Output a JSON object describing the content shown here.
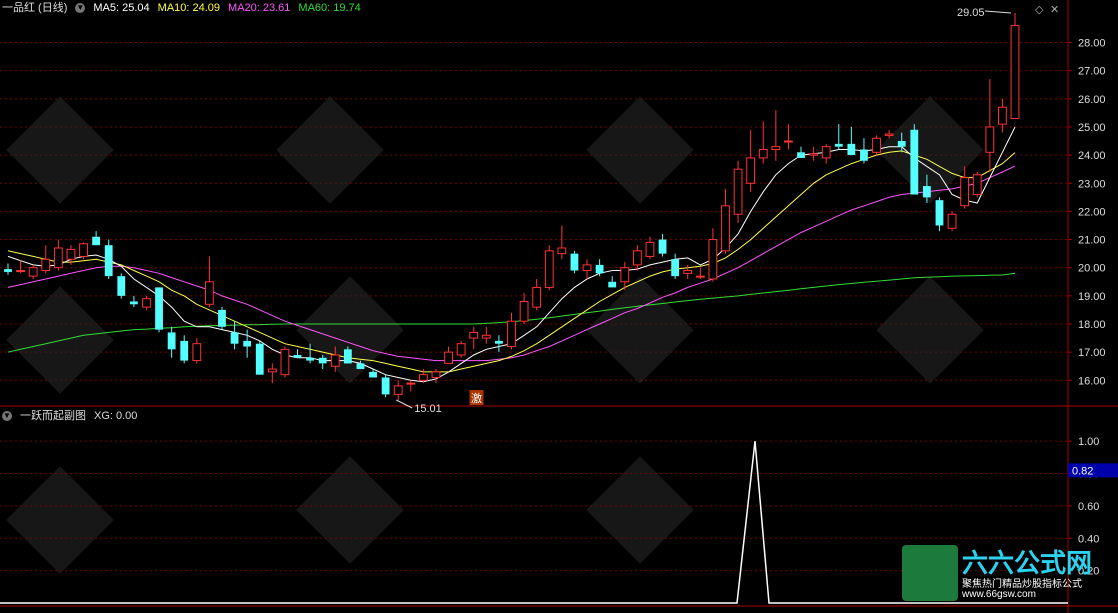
{
  "main_panel": {
    "stock_name": "一品红 (日线)",
    "ma_lines": [
      {
        "label": "MA5: 25.04",
        "color": "#ffffff"
      },
      {
        "label": "MA10: 24.09",
        "color": "#ffff4c"
      },
      {
        "label": "MA20: 23.61",
        "color": "#ff55ff"
      },
      {
        "label": "MA60: 19.74",
        "color": "#33dd33"
      }
    ],
    "high_label": "29.05",
    "low_label": "15.01",
    "signal_char": "激",
    "colors": {
      "up": "#ff3333",
      "down": "#54ffff",
      "grid": "#7a0000",
      "axis": "#aa0000",
      "label": "#dddddd"
    }
  },
  "sub_panel": {
    "title": "一跃而起副图",
    "xg_label": "XG: 0.00",
    "current_value_tag": "0.82",
    "colors": {
      "line": "#ffffff",
      "tag_bg": "#0000aa"
    }
  },
  "watermark": {
    "brand": "六六公式网",
    "slogan": "聚焦热门精品炒股指标公式",
    "url": "www.66gsw.com"
  },
  "chart_data": [
    {
      "type": "candlestick",
      "yticks": [
        16,
        17,
        18,
        19,
        20,
        21,
        22,
        23,
        24,
        25,
        26,
        27,
        28
      ],
      "ylim": [
        15.3,
        28.8
      ],
      "candles": [
        [
          19.95,
          20.15,
          19.75,
          19.85
        ],
        [
          19.9,
          20.25,
          19.8,
          19.9
        ],
        [
          19.7,
          20.1,
          19.6,
          20.0
        ],
        [
          19.9,
          20.8,
          19.8,
          20.3
        ],
        [
          20.0,
          21.0,
          19.9,
          20.7
        ],
        [
          20.3,
          20.8,
          20.1,
          20.65
        ],
        [
          20.4,
          20.9,
          20.3,
          20.85
        ],
        [
          21.1,
          21.3,
          20.8,
          20.8
        ],
        [
          20.8,
          21.0,
          19.6,
          19.7
        ],
        [
          19.7,
          19.8,
          18.9,
          19.0
        ],
        [
          18.8,
          19.0,
          18.6,
          18.7
        ],
        [
          18.6,
          19.0,
          18.5,
          18.9
        ],
        [
          19.3,
          19.3,
          17.7,
          17.8
        ],
        [
          17.7,
          17.9,
          16.8,
          17.1
        ],
        [
          17.4,
          17.6,
          16.6,
          16.7
        ],
        [
          16.7,
          17.5,
          16.6,
          17.3
        ],
        [
          18.7,
          20.4,
          18.6,
          19.5
        ],
        [
          18.5,
          18.6,
          17.8,
          17.9
        ],
        [
          17.7,
          18.1,
          17.1,
          17.3
        ],
        [
          17.4,
          17.8,
          16.8,
          17.2
        ],
        [
          17.3,
          17.4,
          16.2,
          16.2
        ],
        [
          16.3,
          16.6,
          15.9,
          16.4
        ],
        [
          16.2,
          17.2,
          16.1,
          17.1
        ],
        [
          16.9,
          17.1,
          16.8,
          16.8
        ],
        [
          16.8,
          17.3,
          16.6,
          16.7
        ],
        [
          16.8,
          16.9,
          16.4,
          16.6
        ],
        [
          16.5,
          17.2,
          16.3,
          16.9
        ],
        [
          17.1,
          17.2,
          16.6,
          16.6
        ],
        [
          16.6,
          16.7,
          16.4,
          16.4
        ],
        [
          16.3,
          16.4,
          16.1,
          16.1
        ],
        [
          16.1,
          16.2,
          15.4,
          15.5
        ],
        [
          15.5,
          16.0,
          15.3,
          15.8
        ],
        [
          15.9,
          16.0,
          15.6,
          15.9
        ],
        [
          16.0,
          16.4,
          15.9,
          16.2
        ],
        [
          16.1,
          16.4,
          15.9,
          16.3
        ],
        [
          16.6,
          17.2,
          16.6,
          17.0
        ],
        [
          16.9,
          17.4,
          16.8,
          17.3
        ],
        [
          17.5,
          17.9,
          17.1,
          17.7
        ],
        [
          17.5,
          17.9,
          17.3,
          17.6
        ],
        [
          17.4,
          17.6,
          17.0,
          17.3
        ],
        [
          17.2,
          18.4,
          17.1,
          18.1
        ],
        [
          18.1,
          19.1,
          18.0,
          18.8
        ],
        [
          18.6,
          19.6,
          18.5,
          19.3
        ],
        [
          19.3,
          20.8,
          19.2,
          20.6
        ],
        [
          20.5,
          21.5,
          20.3,
          20.7
        ],
        [
          20.5,
          20.6,
          19.8,
          19.9
        ],
        [
          19.9,
          20.3,
          19.6,
          20.1
        ],
        [
          20.1,
          20.3,
          19.7,
          19.8
        ],
        [
          19.5,
          19.7,
          19.3,
          19.3
        ],
        [
          19.5,
          20.2,
          19.2,
          20.0
        ],
        [
          20.1,
          20.8,
          19.9,
          20.6
        ],
        [
          20.4,
          21.1,
          20.3,
          20.9
        ],
        [
          21.0,
          21.2,
          20.4,
          20.5
        ],
        [
          20.3,
          20.5,
          19.6,
          19.7
        ],
        [
          19.8,
          20.1,
          19.6,
          19.9
        ],
        [
          19.7,
          20.0,
          19.6,
          19.7
        ],
        [
          19.6,
          21.4,
          19.5,
          21.0
        ],
        [
          20.6,
          22.8,
          20.5,
          22.2
        ],
        [
          21.9,
          23.8,
          21.6,
          23.5
        ],
        [
          23.0,
          24.9,
          22.7,
          23.9
        ],
        [
          23.9,
          25.2,
          23.7,
          24.2
        ],
        [
          24.2,
          25.6,
          23.8,
          24.3
        ],
        [
          24.5,
          25.1,
          24.2,
          24.5
        ],
        [
          24.1,
          24.3,
          23.9,
          23.9
        ],
        [
          24.0,
          24.3,
          23.8,
          24.05
        ],
        [
          23.9,
          24.4,
          23.7,
          24.3
        ],
        [
          24.4,
          25.1,
          24.2,
          24.3
        ],
        [
          24.4,
          25.0,
          24.1,
          24.0
        ],
        [
          24.2,
          24.6,
          23.7,
          23.8
        ],
        [
          24.1,
          24.7,
          24.0,
          24.6
        ],
        [
          24.7,
          24.9,
          24.6,
          24.75
        ],
        [
          24.5,
          24.8,
          24.1,
          24.3
        ],
        [
          24.9,
          25.1,
          22.6,
          22.6
        ],
        [
          22.9,
          23.3,
          22.3,
          22.5
        ],
        [
          22.4,
          22.5,
          21.3,
          21.5
        ],
        [
          21.4,
          22.0,
          21.3,
          21.9
        ],
        [
          22.2,
          23.6,
          22.1,
          23.2
        ],
        [
          22.6,
          23.4,
          22.5,
          23.3
        ],
        [
          24.1,
          26.7,
          23.4,
          25.0
        ],
        [
          25.1,
          26.0,
          24.8,
          25.7
        ],
        [
          25.3,
          29.05,
          25.3,
          28.6
        ]
      ],
      "ma": {
        "MA5": [
          20.4,
          20.25,
          20.1,
          20.05,
          20.1,
          20.3,
          20.4,
          20.45,
          20.3,
          20.05,
          19.6,
          19.3,
          19.0,
          18.6,
          18.1,
          17.9,
          17.9,
          17.8,
          17.7,
          17.6,
          17.4,
          17.1,
          16.9,
          16.8,
          16.8,
          16.7,
          16.7,
          16.7,
          16.6,
          16.4,
          16.2,
          16.1,
          16.0,
          15.95,
          16.05,
          16.3,
          16.6,
          16.9,
          17.1,
          17.2,
          17.3,
          17.6,
          17.9,
          18.4,
          18.9,
          19.3,
          19.6,
          19.8,
          19.9,
          19.9,
          19.95,
          20.1,
          20.2,
          20.3,
          20.35,
          20.1,
          20.3,
          20.7,
          21.2,
          22.0,
          22.7,
          23.3,
          23.7,
          24.0,
          24.05,
          24.1,
          24.2,
          24.2,
          24.15,
          24.2,
          24.3,
          24.3,
          23.9,
          23.6,
          23.3,
          22.6,
          22.4,
          22.3,
          23.2,
          24.1,
          25.0
        ],
        "MA10": [
          20.6,
          20.5,
          20.4,
          20.3,
          20.2,
          20.2,
          20.25,
          20.3,
          20.2,
          20.1,
          19.9,
          19.7,
          19.5,
          19.2,
          19.0,
          18.7,
          18.5,
          18.3,
          18.1,
          17.9,
          17.7,
          17.5,
          17.3,
          17.2,
          17.1,
          17.0,
          16.9,
          16.8,
          16.75,
          16.7,
          16.6,
          16.5,
          16.4,
          16.3,
          16.3,
          16.3,
          16.4,
          16.5,
          16.6,
          16.7,
          16.85,
          17.05,
          17.3,
          17.6,
          17.9,
          18.2,
          18.5,
          18.8,
          19.05,
          19.3,
          19.5,
          19.7,
          19.85,
          19.95,
          20.0,
          20.05,
          20.15,
          20.35,
          20.65,
          21.0,
          21.4,
          21.8,
          22.2,
          22.6,
          23.0,
          23.3,
          23.5,
          23.7,
          23.85,
          24.0,
          24.1,
          24.15,
          24.0,
          23.85,
          23.6,
          23.35,
          23.2,
          23.2,
          23.45,
          23.7,
          24.09
        ],
        "MA20": [
          19.3,
          19.4,
          19.5,
          19.6,
          19.7,
          19.8,
          19.9,
          20.0,
          20.05,
          20.05,
          20.0,
          19.9,
          19.8,
          19.65,
          19.5,
          19.35,
          19.2,
          19.0,
          18.85,
          18.7,
          18.5,
          18.3,
          18.1,
          17.95,
          17.8,
          17.65,
          17.5,
          17.35,
          17.2,
          17.05,
          16.95,
          16.85,
          16.8,
          16.75,
          16.7,
          16.7,
          16.7,
          16.7,
          16.7,
          16.75,
          16.8,
          16.9,
          17.05,
          17.2,
          17.4,
          17.6,
          17.8,
          18.0,
          18.2,
          18.4,
          18.55,
          18.75,
          18.95,
          19.1,
          19.3,
          19.45,
          19.6,
          19.8,
          20.0,
          20.25,
          20.5,
          20.75,
          21.0,
          21.25,
          21.45,
          21.65,
          21.85,
          22.05,
          22.2,
          22.35,
          22.5,
          22.6,
          22.65,
          22.7,
          22.75,
          22.8,
          22.9,
          23.0,
          23.2,
          23.4,
          23.61
        ],
        "MA60": [
          17.0,
          17.1,
          17.2,
          17.3,
          17.4,
          17.5,
          17.6,
          17.65,
          17.7,
          17.75,
          17.8,
          17.82,
          17.85,
          17.87,
          17.9,
          17.92,
          17.94,
          17.95,
          17.96,
          17.97,
          17.98,
          17.99,
          18.0,
          18.0,
          18.0,
          18.0,
          18.0,
          18.0,
          18.0,
          18.0,
          18.0,
          18.0,
          18.0,
          18.0,
          18.0,
          18.0,
          18.0,
          18.0,
          18.02,
          18.05,
          18.08,
          18.12,
          18.17,
          18.22,
          18.28,
          18.34,
          18.4,
          18.46,
          18.52,
          18.58,
          18.63,
          18.68,
          18.73,
          18.78,
          18.83,
          18.88,
          18.92,
          18.96,
          19.0,
          19.05,
          19.1,
          19.15,
          19.2,
          19.25,
          19.3,
          19.35,
          19.4,
          19.44,
          19.48,
          19.52,
          19.56,
          19.6,
          19.64,
          19.66,
          19.68,
          19.7,
          19.71,
          19.72,
          19.73,
          19.74,
          19.8
        ]
      }
    },
    {
      "type": "line",
      "yticks": [
        0.2,
        0.4,
        0.6,
        0.8,
        1.0
      ],
      "ylim": [
        0,
        1.1
      ],
      "signal_index": 57,
      "values": "0 everywhere except 1.00 at signal_index"
    }
  ]
}
